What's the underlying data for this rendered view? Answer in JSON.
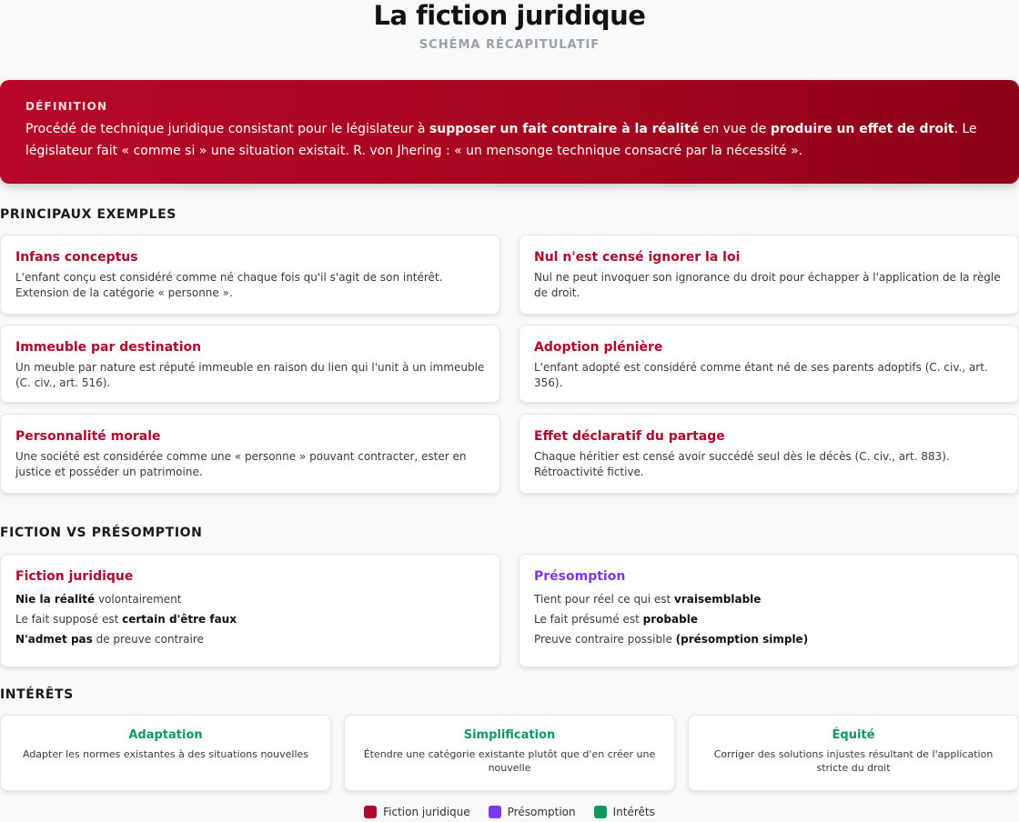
{
  "header": {
    "title": "La fiction juridique",
    "subtitle": "SCHÉMA RÉCAPITULATIF"
  },
  "definition": {
    "label": "DÉFINITION",
    "text_1": "Procédé de technique juridique consistant pour le législateur à ",
    "bold_1": "supposer un fait contraire à la réalité",
    "text_2": " en vue de ",
    "bold_2": "produire un effet de droit",
    "text_3": ". Le législateur fait « comme si » une situation existait. R. von Jhering : « un mensonge technique consacré par la nécessité »."
  },
  "examples": {
    "section_title": "PRINCIPAUX EXEMPLES",
    "items": [
      {
        "title": "Infans conceptus",
        "text": "L'enfant conçu est considéré comme né chaque fois qu'il s'agit de son intérêt. Extension de la catégorie « personne »."
      },
      {
        "title": "Nul n'est censé ignorer la loi",
        "text": "Nul ne peut invoquer son ignorance du droit pour échapper à l'application de la règle de droit."
      },
      {
        "title": "Immeuble par destination",
        "text": "Un meuble par nature est réputé immeuble en raison du lien qui l'unit à un immeuble (C. civ., art. 516)."
      },
      {
        "title": "Adoption plénière",
        "text": "L'enfant adopté est considéré comme étant né de ses parents adoptifs (C. civ., art. 356)."
      },
      {
        "title": "Personnalité morale",
        "text": "Une société est considérée comme une « personne » pouvant contracter, ester en justice et posséder un patrimoine."
      },
      {
        "title": "Effet déclaratif du partage",
        "text": "Chaque héritier est censé avoir succédé seul dès le décès (C. civ., art. 883). Rétroactivité fictive."
      }
    ]
  },
  "comparison": {
    "section_title": "FICTION VS PRÉSOMPTION",
    "fiction": {
      "title": "Fiction juridique",
      "l1_bold": "Nie la réalité",
      "l1_rest": " volontairement",
      "l2_pre": "Le fait supposé est ",
      "l2_bold": "certain d'être faux",
      "l3_bold": "N'admet pas",
      "l3_rest": " de preuve contraire"
    },
    "presomption": {
      "title": "Présomption",
      "l1_pre": "Tient pour réel ce qui est ",
      "l1_bold": "vraisemblable",
      "l2_pre": "Le fait présumé est ",
      "l2_bold": "probable",
      "l3_pre": "Preuve contraire possible ",
      "l3_bold": "(présomption simple)"
    }
  },
  "interets": {
    "section_title": "INTÉRÊTS",
    "items": [
      {
        "title": "Adaptation",
        "text": "Adapter les normes existantes à des situations nouvelles"
      },
      {
        "title": "Simplification",
        "text": "Étendre une catégorie existante plutôt que d'en créer une nouvelle"
      },
      {
        "title": "Équité",
        "text": "Corriger des solutions injustes résultant de l'application stricte du droit"
      }
    ]
  },
  "legend": {
    "fiction": "Fiction juridique",
    "presomption": "Présomption",
    "interets": "Intérêts"
  },
  "colors": {
    "fiction": "#b0062a",
    "presomption": "#7c3aed",
    "interets": "#0f9960"
  }
}
